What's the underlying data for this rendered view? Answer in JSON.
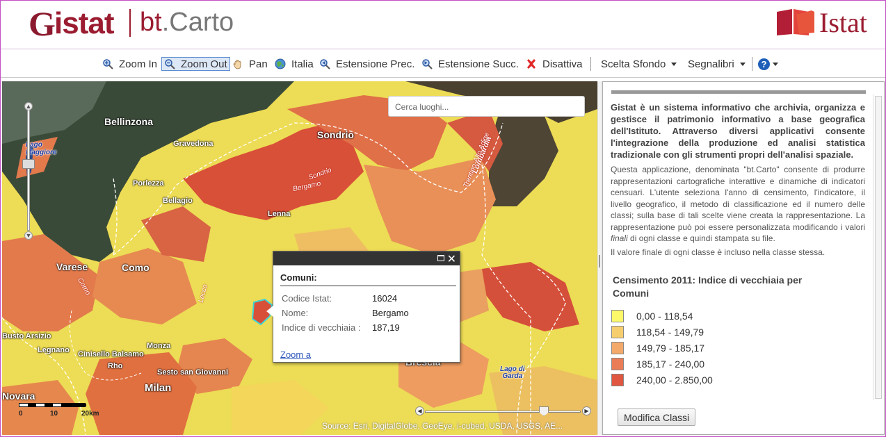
{
  "header": {
    "logo_g": "G",
    "logo_rest": "istat",
    "logo_bt": "bt",
    "logo_carto": ".Carto",
    "istat_brand": "Istat"
  },
  "toolbar": {
    "zoom_in": "Zoom In",
    "zoom_out": "Zoom Out",
    "pan": "Pan",
    "italia": "Italia",
    "estensione_prec": "Estensione Prec.",
    "estensione_succ": "Estensione Succ.",
    "disattiva": "Disattiva",
    "scelta_sfondo": "Scelta Sfondo",
    "segnalibri": "Segnalibri"
  },
  "map": {
    "search_placeholder": "Cerca luoghi...",
    "labels": {
      "bellinzona": "Bellinzona",
      "lago_maggiore": "Lago\nMaggiore",
      "gravedona": "Gravedona",
      "porlezza": "Porlezza",
      "bellagio": "Bellagio",
      "sondrio": "Sondrio",
      "lenna": "Lenna",
      "varese": "Varese",
      "como": "Como",
      "busto_arsizio": "Busto Arsizio",
      "legnano": "Legnano",
      "cinisello_balsamo": "Cinisello Balsamo",
      "monza": "Monza",
      "rho": "Rho",
      "sesto_san_giovanni": "Sesto san Giovanni",
      "milan": "Milan",
      "novara": "Novara",
      "brescia": "Brescia",
      "lago_di_garda": "Lago di\nGarda",
      "lombardia": "Lombardia",
      "trentino": "Trentino-Alto Adige",
      "bergamo_road": "Bergamo",
      "sondrio_road": "Sondrio",
      "lecco_road": "Lecco",
      "como_road": "Como"
    },
    "scale": {
      "l0": "0",
      "l10": "10",
      "l20": "20km"
    },
    "attribution": "Source: Esri, DigitalGlobe, GeoEye, i-cubed, USDA, USGS, AE..."
  },
  "popup": {
    "title": "Comuni:",
    "fields": [
      {
        "label": "Codice Istat:",
        "value": "16024"
      },
      {
        "label": "Nome:",
        "value": "Bergamo"
      },
      {
        "label": "Indice di vecchiaia :",
        "value": "187,19"
      }
    ],
    "zoom_link": "Zoom a"
  },
  "panel": {
    "intro_bold": "Gistat è un sistema informativo che archivia, organizza e gestisce il patrimonio informativo a base geografica dell'Istituto. Attraverso diversi applicativi consente l'integrazione della produzione ed analisi statistica tradizionale con gli strumenti propri dell'analisi spaziale.",
    "intro_text_a": "Questa applicazione, denominata \"bt.Carto\" consente di produrre rappresentazioni cartografiche interattive e dinamiche di indicatori censuari. L'utente seleziona l'anno di censimento, l'indicatore, il livello geografico, il metodo di classificazione ed il numero delle classi; sulla base di tali scelte viene creata la rappresentazione. La rappresentazione può poi essere personalizzata modificando i valori ",
    "intro_text_em": "finali",
    "intro_text_b": " di ogni classe e quindi stampata su file.",
    "note": "Il valore finale di ogni classe è incluso nella classe stessa.",
    "legend_title": "Censimento 2011: Indice di vecchiaia per Comuni",
    "legend": [
      {
        "label": "0,00 - 118,54",
        "color": "#fdf86a"
      },
      {
        "label": "118,54 - 149,79",
        "color": "#f7ce6e"
      },
      {
        "label": "149,79 - 185,17",
        "color": "#f3a96a"
      },
      {
        "label": "185,17 - 240,00",
        "color": "#ea7c57"
      },
      {
        "label": "240,00 - 2.850,00",
        "color": "#df5740"
      }
    ],
    "modify_button": "Modifica Classi"
  },
  "colors": {
    "brand": "#9b1c30",
    "accent_border": "#c24fc4",
    "link": "#2a55b8"
  }
}
